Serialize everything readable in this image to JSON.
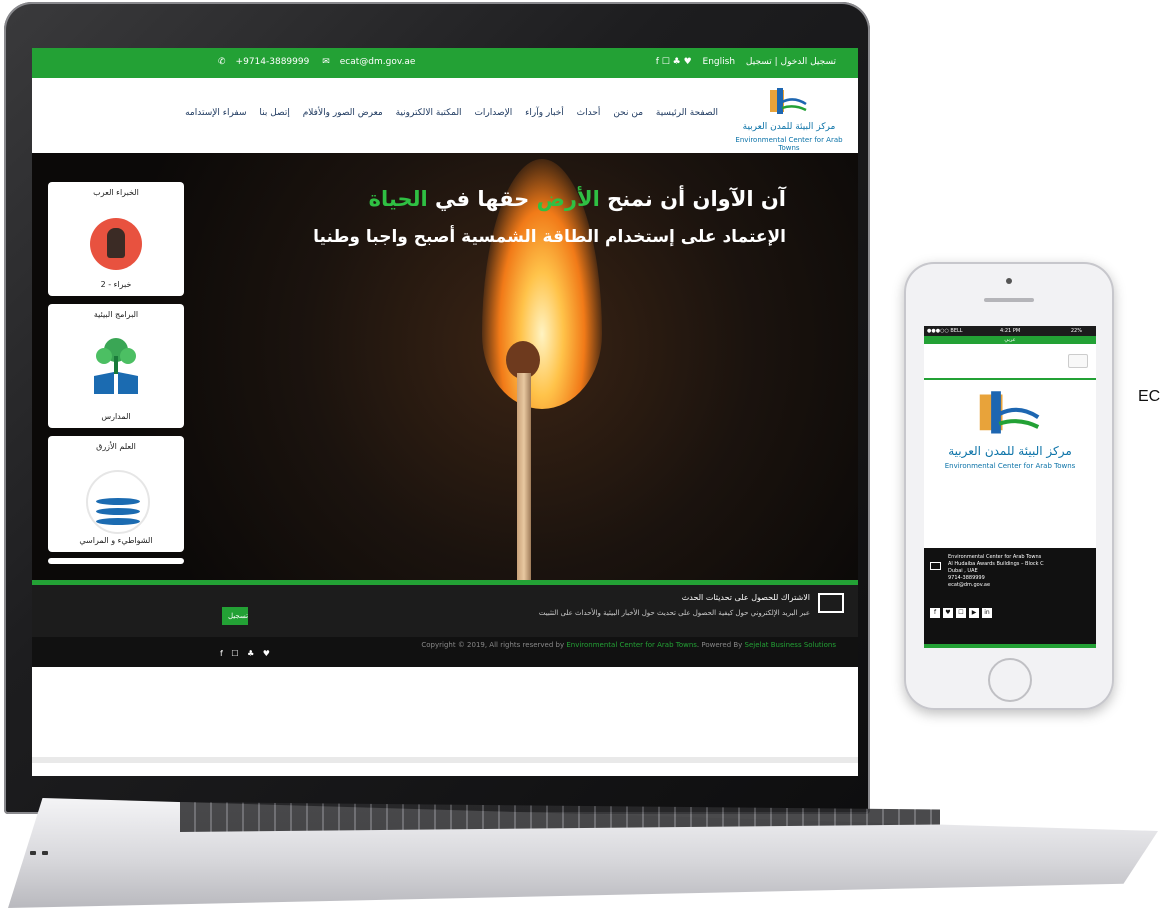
{
  "topbar": {
    "phone": "+9714-3889999",
    "email": "ecat@dm.gov.ae",
    "social": "f ☐ ♣ ♥",
    "lang": "English",
    "auth": "تسجيل الدخول | تسجيل"
  },
  "logo": {
    "arabic": "مركز البيئة للمدن العربية",
    "english": "Environmental Center for Arab Towns"
  },
  "nav": {
    "items": [
      "الصفحة الرئيسية",
      "من نحن",
      "أحداث",
      "أخبار وآراء",
      "الإصدارات",
      "المكتبة الالكترونية",
      "معرض الصور والأفلام",
      "إتصل بنا",
      "سفراء الإستدامه"
    ]
  },
  "hero": {
    "title_part1": "آن الآوان أن نمنح",
    "title_highlight1": "الأرض",
    "title_part2": "حقها في",
    "title_highlight2": "الحياة",
    "subtitle": "الإعتماد على إستخدام الطاقة الشمسية أصبح واجبا وطنيا"
  },
  "cards": [
    {
      "title": "الخبراء العرب",
      "caption": "2 - خبراء"
    },
    {
      "title": "البرامج البيئية",
      "caption": "المدارس"
    },
    {
      "title": "العلم الأزرق",
      "caption": "الشواطيء و المراسي"
    }
  ],
  "subscribe": {
    "title": "الاشتراك للحصول على تحديثات الحدث",
    "desc": "عبر البريد الإلكتروني حول كيفية الحصول على تحديث حول الأخبار البيئية والأحداث على التثبيت",
    "button": "تسجيل"
  },
  "footer": {
    "copyright_pre": "Copyright © 2019, All rights reserved by ",
    "copyright_org": "Environmental Center for Arab Towns",
    "copyright_mid": ". Powered By ",
    "copyright_vendor": "Sejelat Business Solutions",
    "social": "f ☐ ♣ ♥"
  },
  "phone": {
    "carrier": "●●●○○ BELL",
    "time": "4:21 PM",
    "battery": "22%",
    "topbar": "عربي",
    "logo_ar": "مركز البيئة للمدن العربية",
    "logo_en": "Environmental Center for Arab Towns",
    "address": [
      "Environmental Center for Arab Towns",
      "Al Hudaiba Awards Buildings – Block C",
      "Dubai , UAE",
      "9714-3889999",
      "ecat@dm.gov.ae"
    ],
    "social": [
      "f",
      "♥",
      "☐",
      "▶",
      "in"
    ]
  },
  "side_label": "EC",
  "colors": {
    "brand_green": "#23a135",
    "logo_blue": "#0c73a8",
    "footer_dark": "#111111"
  }
}
